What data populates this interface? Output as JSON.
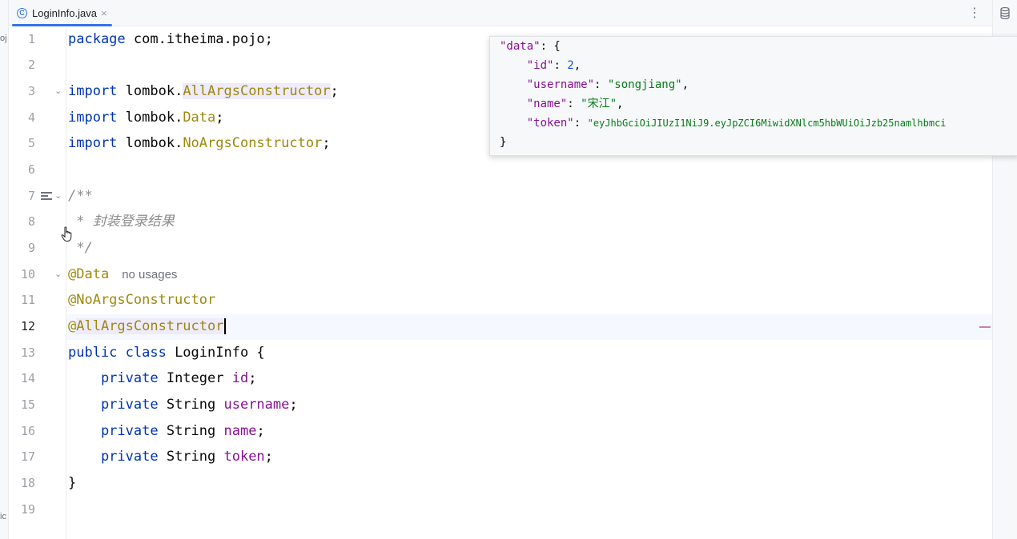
{
  "tab": {
    "icon": "class-icon",
    "icon_glyph": "C",
    "title": "LoginInfo.java",
    "close": "×"
  },
  "menu_glyph": "⋮",
  "left_strip": {
    "top_text": "oj",
    "bottom_text": "ic"
  },
  "line_numbers": [
    "1",
    "2",
    "3",
    "4",
    "5",
    "6",
    "7",
    "8",
    "9",
    "10",
    "11",
    "12",
    "13",
    "14",
    "15",
    "16",
    "17",
    "18",
    "19"
  ],
  "current_line": 12,
  "fold_glyph": "⌄",
  "code": {
    "l1_kw": "package",
    "l1_rest": " com.itheima.pojo;",
    "l3_kw": "import",
    "l3_pkg": " lombok.",
    "l3_cls": "AllArgsConstructor",
    "l3_end": ";",
    "l4_kw": "import",
    "l4_pkg": " lombok.",
    "l4_cls": "Data",
    "l4_end": ";",
    "l5_kw": "import",
    "l5_pkg": " lombok.",
    "l5_cls": "NoArgsConstructor",
    "l5_end": ";",
    "l7": "/**",
    "l8_star": " * ",
    "l8_text": "封装登录结果",
    "l9": " */",
    "l10_ann": "@Data",
    "l10_usage": "no usages",
    "l11_ann": "@NoArgsConstructor",
    "l12_at": "@",
    "l12_ann": "AllArgsConstructor",
    "l13_kw": "public class",
    "l13_rest": " LoginInfo {",
    "l14_kw": "    private",
    "l14_type": " Integer ",
    "l14_field": "id",
    "l14_end": ";",
    "l15_kw": "    private",
    "l15_type": " String ",
    "l15_field": "username",
    "l15_end": ";",
    "l16_kw": "    private",
    "l16_type": " String ",
    "l16_field": "name",
    "l16_end": ";",
    "l17_kw": "    private",
    "l17_type": " String ",
    "l17_field": "token",
    "l17_end": ";",
    "l18": "}"
  },
  "popup": {
    "data_key": "\"data\"",
    "open": ": {",
    "id_key": "\"id\"",
    "id_val": "2",
    "username_key": "\"username\"",
    "username_val": "\"songjiang\"",
    "name_key": "\"name\"",
    "name_val": "\"宋江\"",
    "token_key": "\"token\"",
    "token_val": "\"eyJhbGciOiJIUzI1NiJ9.eyJpZCI6MiwidXNlcm5hbWUiOiJzb25namlhbmci",
    "sep": ": ",
    "comma": ",",
    "close": "}"
  },
  "colors": {
    "keyword": "#0033b3",
    "annotation": "#9e880d",
    "field": "#871094",
    "string": "#067d17",
    "number": "#1750eb",
    "accent": "#3574f0"
  }
}
